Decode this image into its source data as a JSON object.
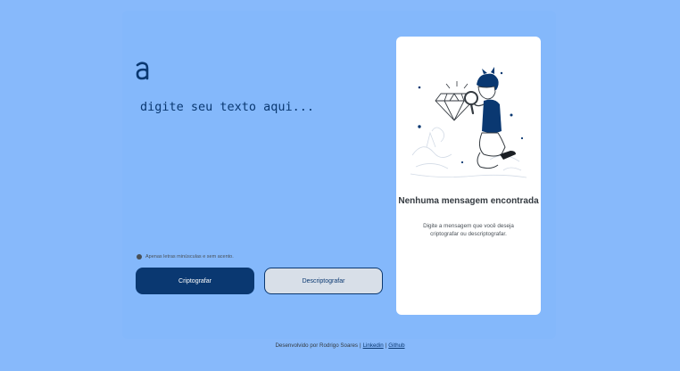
{
  "input": {
    "placeholder": "digite seu texto aqui...",
    "value": ""
  },
  "hint": {
    "icon": "info-icon",
    "text": "Apenas letras minúsculas e sem acento."
  },
  "buttons": {
    "encrypt_label": "Criptografar",
    "decrypt_label": "Descriptografar"
  },
  "output": {
    "title": "Nenhuma mensagem encontrada",
    "subtitle": "Digite a mensagem que você deseja criptografar ou descriptografar."
  },
  "footer": {
    "credit": "Desenvolvido por Rodrigo Soares",
    "links": [
      "Linkedin",
      "Github"
    ]
  },
  "colors": {
    "background": "#87b9fb",
    "primary": "#0a3871",
    "card": "#ffffff",
    "secondary_button": "#d8dfe8"
  },
  "icons": {
    "logo": "alura-logo-icon",
    "illustration": "person-with-magnifier-illustration"
  }
}
